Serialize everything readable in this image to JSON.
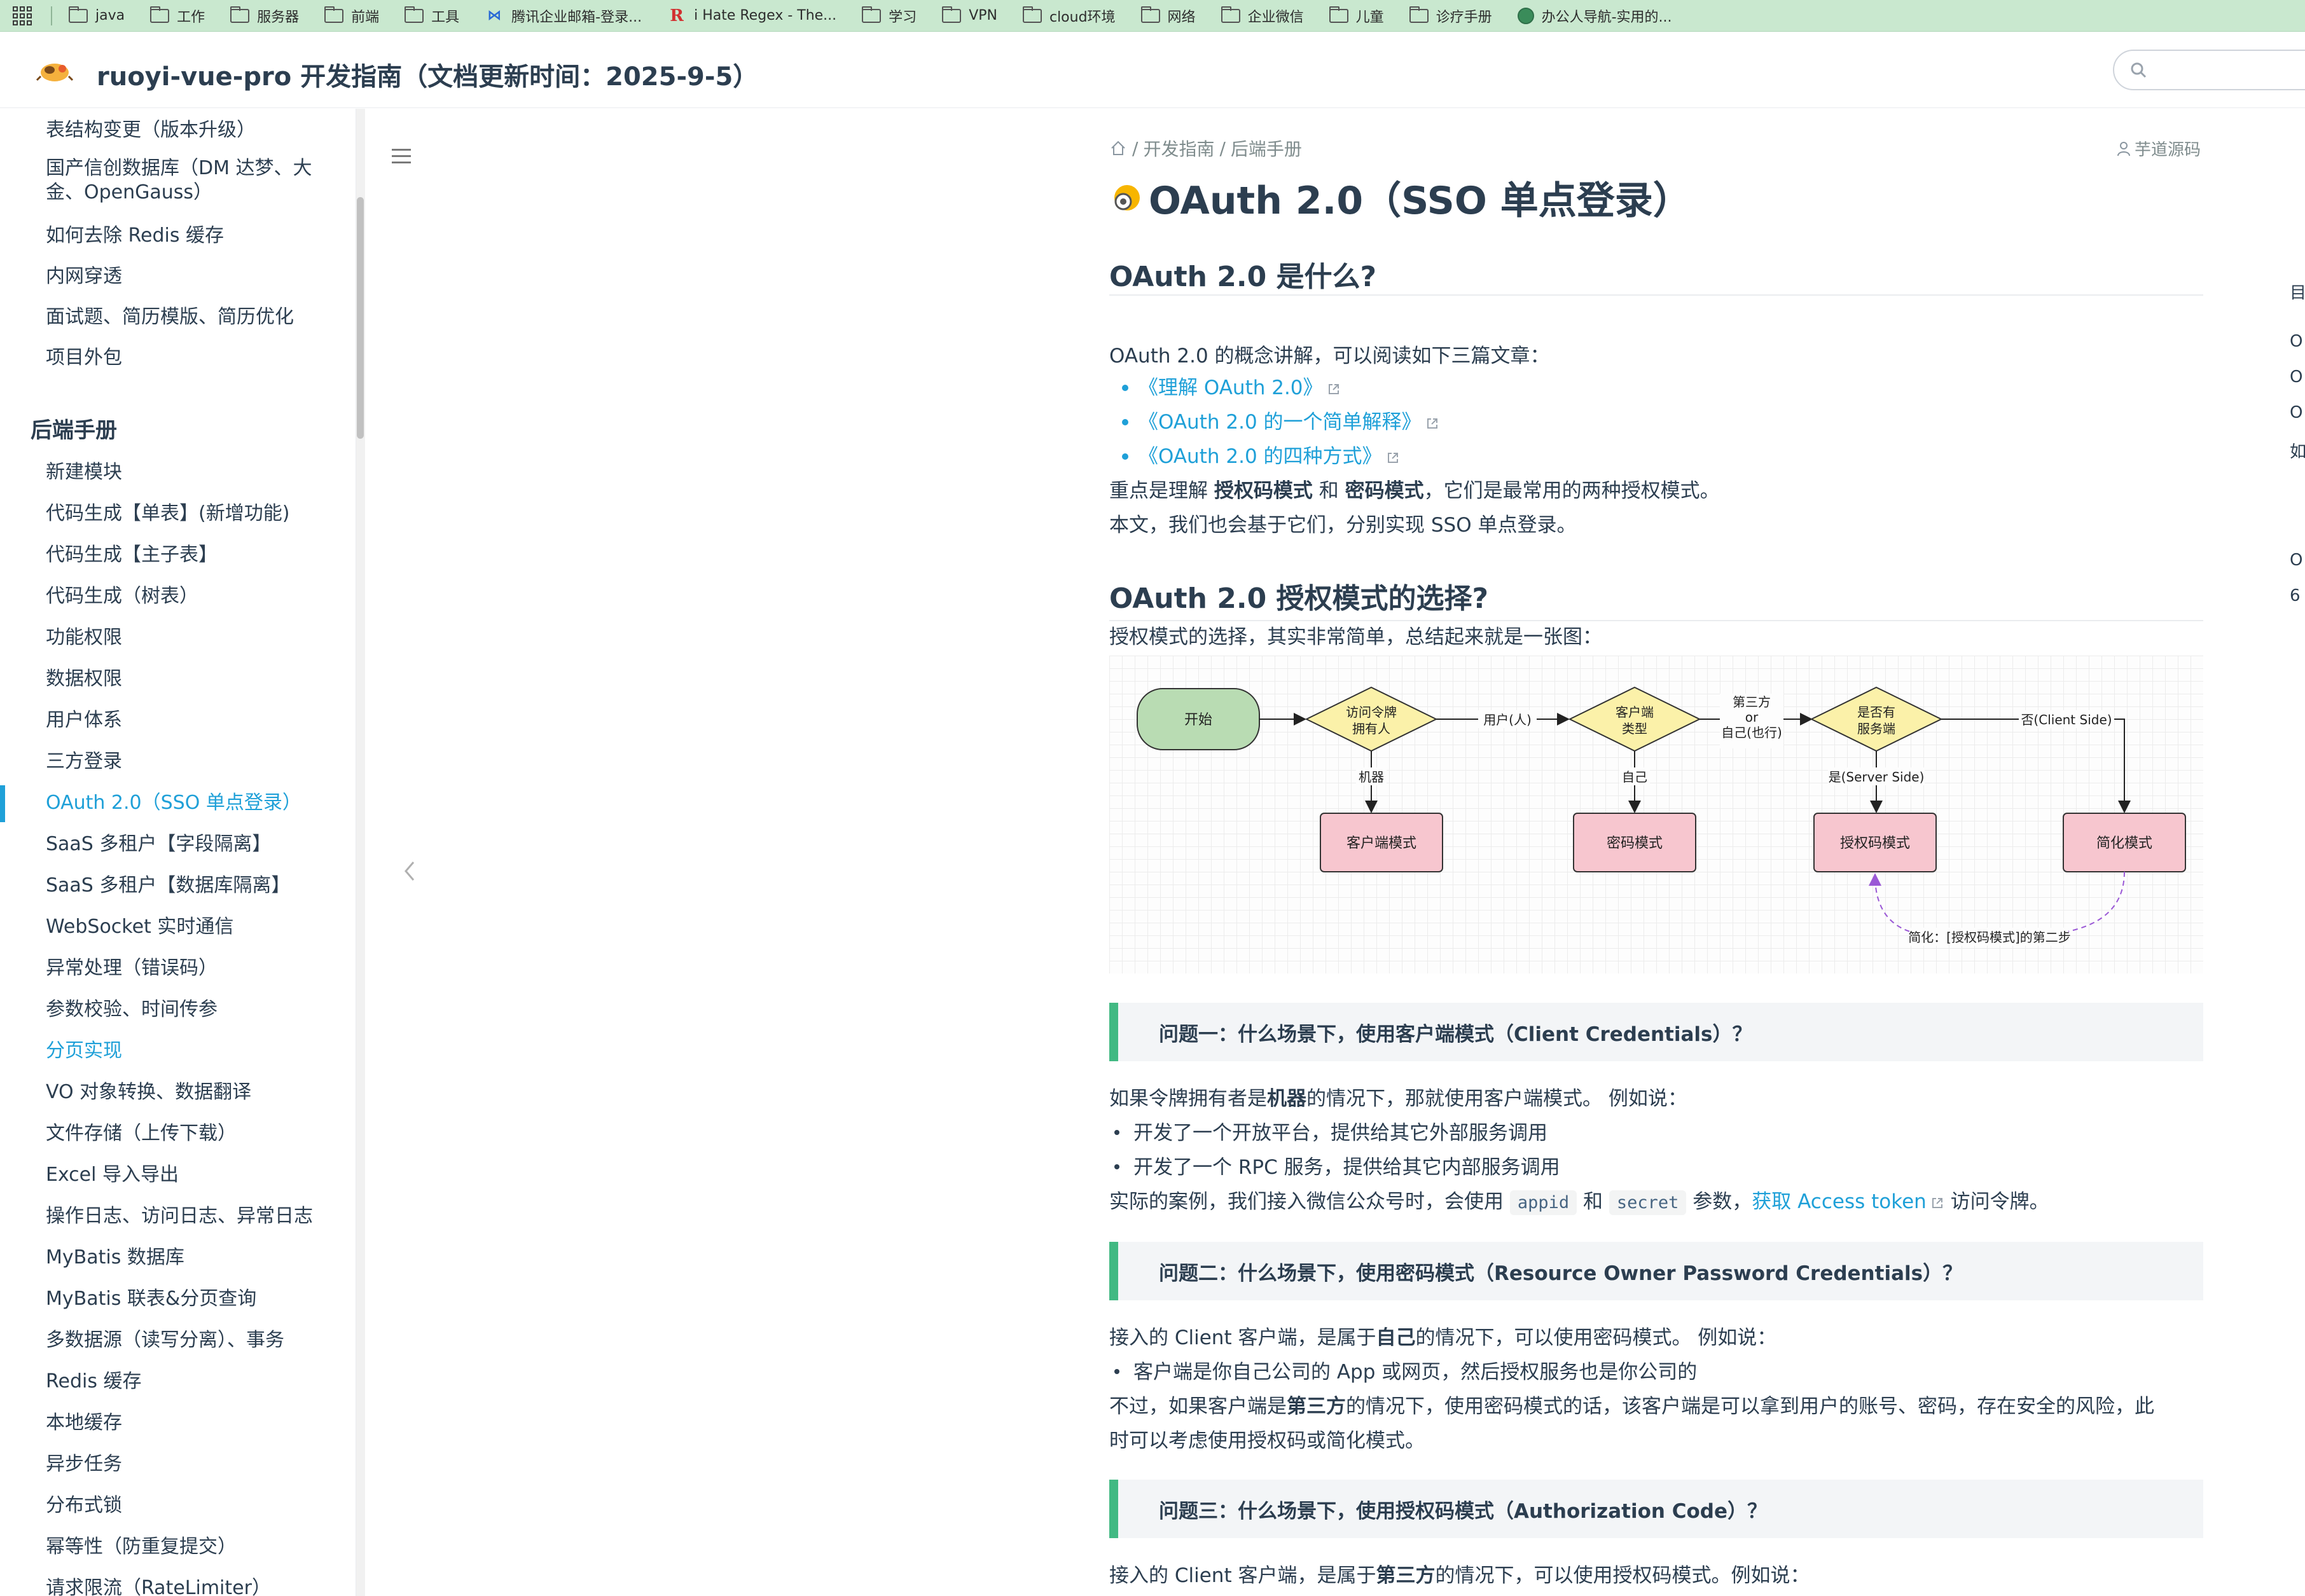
{
  "bookmarks": [
    {
      "label": "java",
      "icon": "folder-icon"
    },
    {
      "label": "工作",
      "icon": "folder-icon"
    },
    {
      "label": "服务器",
      "icon": "folder-icon"
    },
    {
      "label": "前端",
      "icon": "folder-icon"
    },
    {
      "label": "工具",
      "icon": "folder-icon"
    },
    {
      "label": "腾讯企业邮箱-登录...",
      "icon": "mail-icon"
    },
    {
      "label": "i Hate Regex - The...",
      "icon": "r-icon"
    },
    {
      "label": "学习",
      "icon": "folder-icon"
    },
    {
      "label": "VPN",
      "icon": "folder-icon"
    },
    {
      "label": "cloud环境",
      "icon": "folder-icon"
    },
    {
      "label": "网络",
      "icon": "folder-icon"
    },
    {
      "label": "企业微信",
      "icon": "folder-icon"
    },
    {
      "label": "儿童",
      "icon": "folder-icon"
    },
    {
      "label": "诊疗手册",
      "icon": "folder-icon"
    },
    {
      "label": "办公人导航-实用的...",
      "icon": "globe-icon"
    }
  ],
  "header": {
    "title": "ruoyi-vue-pro 开发指南（文档更新时间：2025-9-5）"
  },
  "sidebar": {
    "top_items": [
      "表结构变更（版本升级）",
      "国产信创数据库（DM 达梦、大",
      "金、OpenGauss）",
      "如何去除 Redis 缓存",
      "内网穿透",
      "面试题、简历模版、简历优化",
      "项目外包"
    ],
    "section_title": "后端手册",
    "items": [
      "新建模块",
      "代码生成【单表】(新增功能)",
      "代码生成【主子表】",
      "代码生成（树表）",
      "功能权限",
      "数据权限",
      "用户体系",
      "三方登录",
      "OAuth 2.0（SSO 单点登录）",
      "SaaS 多租户【字段隔离】",
      "SaaS 多租户【数据库隔离】",
      "WebSocket 实时通信",
      "异常处理（错误码）",
      "参数校验、时间传参",
      "分页实现",
      "VO 对象转换、数据翻译",
      "文件存储（上传下载）",
      "Excel 导入导出",
      "操作日志、访问日志、异常日志",
      "MyBatis 数据库",
      "MyBatis 联表&分页查询",
      "多数据源（读写分离）、事务",
      "Redis 缓存",
      "本地缓存",
      "异步任务",
      "分布式锁",
      "幂等性（防重复提交）",
      "请求限流（RateLimiter）"
    ]
  },
  "breadcrumb": {
    "sep": "/",
    "items": [
      "开发指南",
      "后端手册"
    ]
  },
  "author": "芋道源码",
  "page_title": "OAuth 2.0（SSO 单点登录）",
  "section1": {
    "heading": "OAuth 2.0 是什么?",
    "intro": "OAuth 2.0 的概念讲解，可以阅读如下三篇文章：",
    "links": [
      "《理解 OAuth 2.0》",
      "《OAuth 2.0 的一个简单解释》",
      "《OAuth 2.0 的四种方式》"
    ],
    "p1_a": "重点是理解 ",
    "p1_b": "授权码模式",
    "p1_c": " 和 ",
    "p1_d": "密码模式",
    "p1_e": "，它们是最常用的两种授权模式。",
    "p2": "本文，我们也会基于它们，分别实现 SSO 单点登录。"
  },
  "section2": {
    "heading": "OAuth 2.0 授权模式的选择?",
    "intro": "授权模式的选择，其实非常简单，总结起来就是一张图："
  },
  "diagram": {
    "start": "开始",
    "d1a": "访问令牌",
    "d1b": "拥有人",
    "e_user": "用户(人)",
    "d2a": "客户端",
    "d2b": "类型",
    "e_third1": "第三方",
    "e_third2": "or",
    "e_third3": "自己(也行)",
    "d3a": "是否有",
    "d3b": "服务端",
    "e_no": "否(Client Side)",
    "e_machine": "机器",
    "e_self": "自己",
    "e_yes": "是(Server Side)",
    "box1": "客户端模式",
    "box2": "密码模式",
    "box3": "授权码模式",
    "box4": "简化模式",
    "note": "简化：[授权码模式]的第二步"
  },
  "q1": {
    "title": "问题一：什么场景下，使用客户端模式（Client Credentials）？",
    "p_a": "如果令牌拥有者是",
    "p_b": "机器",
    "p_c": "的情况下，那就使用客户端模式。 例如说：",
    "bullets": [
      "开发了一个开放平台，提供给其它外部服务调用",
      "开发了一个 RPC 服务，提供给其它内部服务调用"
    ],
    "case_a": "实际的案例，我们接入微信公众号时，会使用 ",
    "code1": "appid",
    "case_b": " 和 ",
    "code2": "secret",
    "case_c": " 参数，",
    "case_link": "获取 Access token",
    "case_d": " 访问令牌。"
  },
  "q2": {
    "title": "问题二：什么场景下，使用密码模式（Resource Owner Password Credentials）？",
    "p_a": "接入的 Client 客户端，是属于",
    "p_b": "自己",
    "p_c": "的情况下，可以使用密码模式。 例如说：",
    "bullet": "客户端是你自己公司的 App 或网页，然后授权服务也是你公司的",
    "p2_a": "不过，如果客户端是",
    "p2_b": "第三方",
    "p2_c": "的情况下，使用密码模式的话，该客户端是可以拿到用户的账号、密码，存在安全的风险，此",
    "p3": "时可以考虑使用授权码或简化模式。"
  },
  "q3": {
    "title": "问题三：什么场景下，使用授权码模式（Authorization Code）？",
    "p_a": "接入的 Client 客户端，是属于",
    "p_b": "第三方",
    "p_c": "的情况下，可以使用授权码模式。例如说："
  },
  "toc": [
    "目",
    "O",
    "O",
    "O",
    "如",
    "O",
    "6"
  ]
}
